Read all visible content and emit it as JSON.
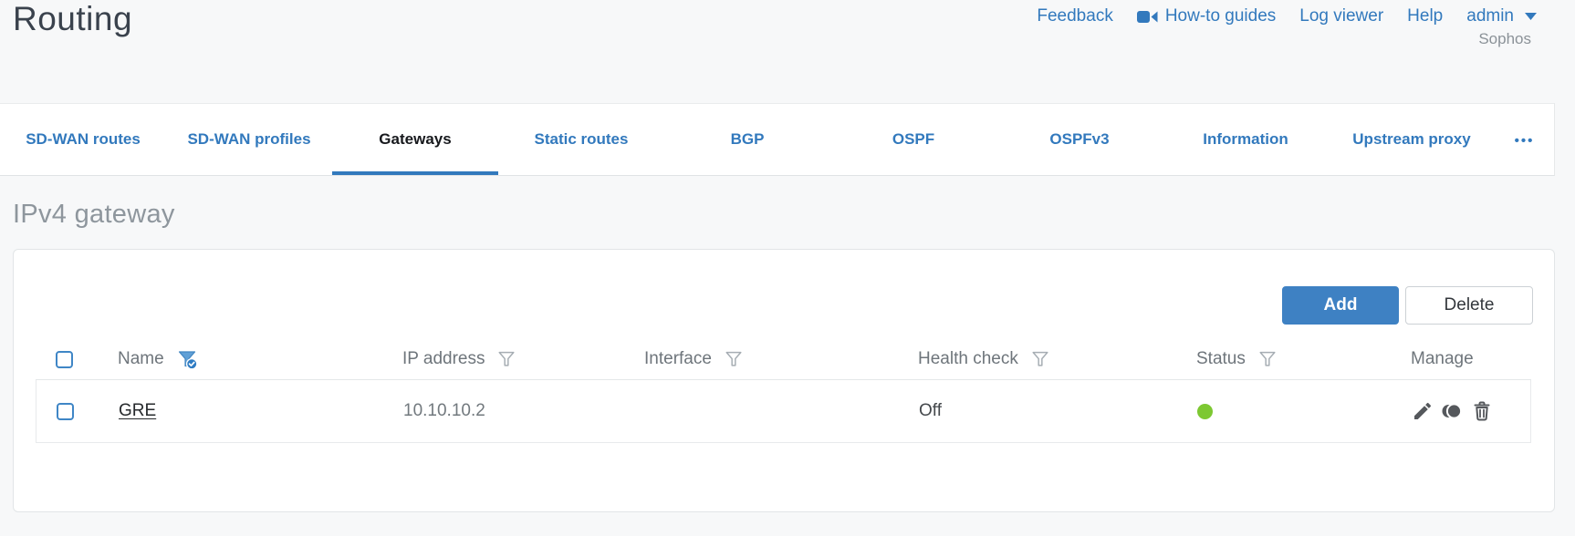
{
  "header": {
    "title": "Routing",
    "nav": {
      "feedback": "Feedback",
      "howto_guides": "How-to guides",
      "log_viewer": "Log viewer",
      "help": "Help",
      "user": "admin",
      "vendor": "Sophos"
    }
  },
  "tabs": {
    "items": [
      {
        "label": "SD-WAN routes",
        "active": false
      },
      {
        "label": "SD-WAN profiles",
        "active": false
      },
      {
        "label": "Gateways",
        "active": true
      },
      {
        "label": "Static routes",
        "active": false
      },
      {
        "label": "BGP",
        "active": false
      },
      {
        "label": "OSPF",
        "active": false
      },
      {
        "label": "OSPFv3",
        "active": false
      },
      {
        "label": "Information",
        "active": false
      },
      {
        "label": "Upstream proxy",
        "active": false
      }
    ],
    "overflow": "•••"
  },
  "section": {
    "title": "IPv4 gateway"
  },
  "toolbar": {
    "add_label": "Add",
    "delete_label": "Delete"
  },
  "table": {
    "columns": [
      {
        "label": "Name",
        "filter": "active"
      },
      {
        "label": "IP address",
        "filter": "inactive"
      },
      {
        "label": "Interface",
        "filter": "inactive"
      },
      {
        "label": "Health check",
        "filter": "inactive"
      },
      {
        "label": "Status",
        "filter": "inactive"
      },
      {
        "label": "Manage",
        "filter": "none"
      }
    ],
    "rows": [
      {
        "name": "GRE",
        "ip_address": "10.10.10.2",
        "interface": "",
        "health_check": "Off",
        "status": "up"
      }
    ]
  },
  "colors": {
    "accent_blue": "#3279bd",
    "button_blue": "#3e81c3",
    "status_up_green": "#7dc832",
    "icon_gray": "#55585c"
  }
}
